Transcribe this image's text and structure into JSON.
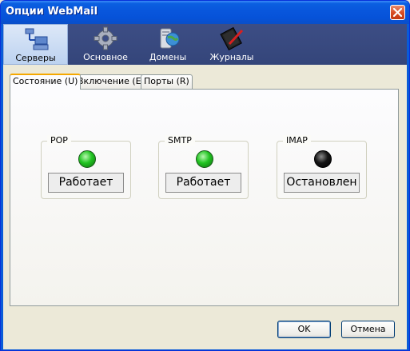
{
  "window": {
    "title": "Опции WebMail"
  },
  "toolbar": {
    "items": [
      {
        "label": "Серверы",
        "icon": "servers-icon",
        "active": true
      },
      {
        "label": "Основное",
        "icon": "gear-icon",
        "active": false
      },
      {
        "label": "Домены",
        "icon": "domains-icon",
        "active": false
      },
      {
        "label": "Журналы",
        "icon": "logs-icon",
        "active": false
      }
    ]
  },
  "tabs": [
    {
      "label": "Состояние (U)",
      "active": true
    },
    {
      "label": "Включение (E)",
      "active": false
    },
    {
      "label": "Порты (R)",
      "active": false
    }
  ],
  "services": [
    {
      "name": "POP",
      "status": "Работает",
      "led_color": "#22C422"
    },
    {
      "name": "SMTP",
      "status": "Работает",
      "led_color": "#22C422"
    },
    {
      "name": "IMAP",
      "status": "Остановлен",
      "led_color": "#000000"
    }
  ],
  "buttons": {
    "ok": "OK",
    "cancel": "Отмена"
  }
}
